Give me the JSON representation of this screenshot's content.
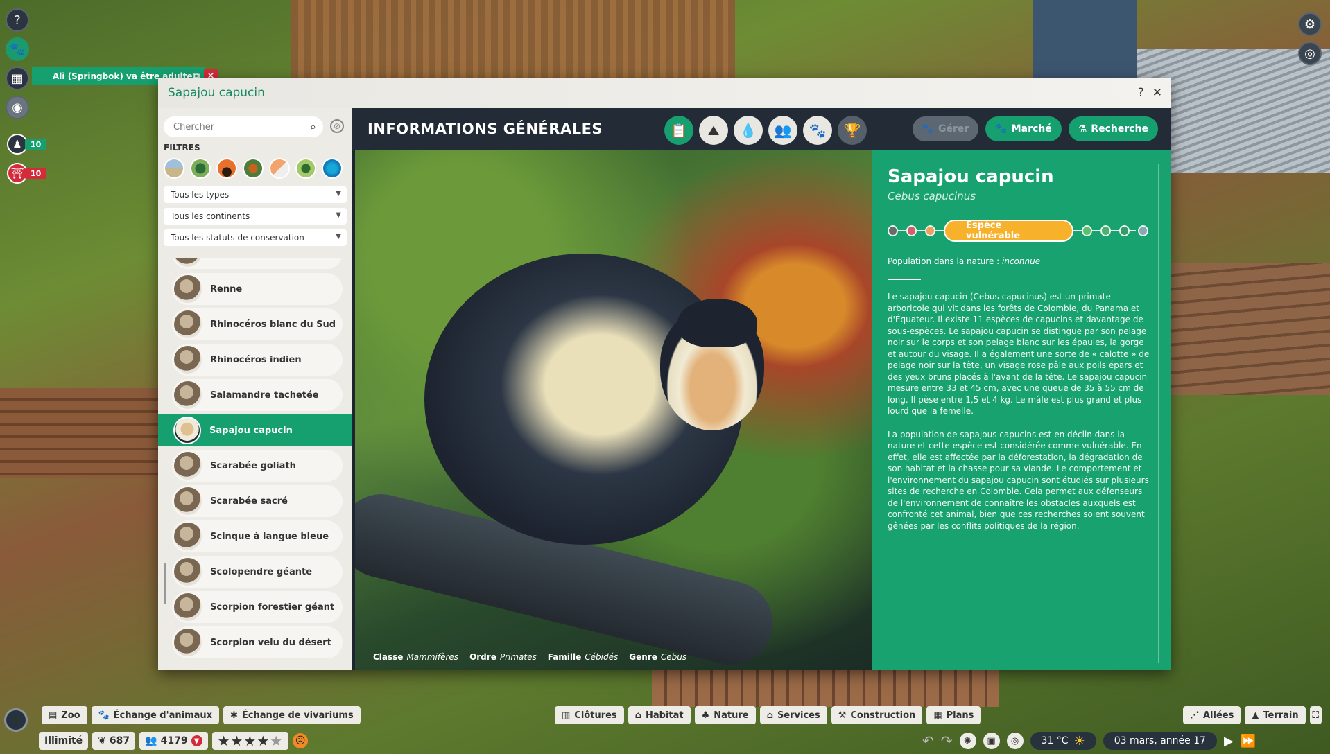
{
  "notification": {
    "text": "Ali (Springbok) va être adulte"
  },
  "hud": {
    "staff_count": "10",
    "guest_alert_count": "10"
  },
  "window": {
    "title": "Sapajou capucin",
    "help": "?",
    "close": "✕"
  },
  "sidebar": {
    "search_placeholder": "Chercher",
    "filters_label": "FILTRES",
    "dropdowns": [
      "Tous les types",
      "Tous les continents",
      "Tous les statuts de conservation"
    ],
    "animals": [
      {
        "name": "Renne"
      },
      {
        "name": "Rhinocéros blanc du Sud"
      },
      {
        "name": "Rhinocéros indien"
      },
      {
        "name": "Salamandre tachetée"
      },
      {
        "name": "Sapajou capucin"
      },
      {
        "name": "Scarabée goliath"
      },
      {
        "name": "Scarabée sacré"
      },
      {
        "name": "Scinque à langue bleue"
      },
      {
        "name": "Scolopendre géante"
      },
      {
        "name": "Scorpion forestier géant"
      },
      {
        "name": "Scorpion velu du désert"
      }
    ]
  },
  "content": {
    "header_title": "INFORMATIONS GÉNÉRALES",
    "buttons": {
      "manage": "Gérer",
      "market": "Marché",
      "research": "Recherche"
    }
  },
  "photo": {
    "taxonomy": [
      {
        "label": "Classe",
        "value": "Mammifères"
      },
      {
        "label": "Ordre",
        "value": "Primates"
      },
      {
        "label": "Famille",
        "value": "Cébidés"
      },
      {
        "label": "Genre",
        "value": "Cebus"
      }
    ]
  },
  "info": {
    "name": "Sapajou capucin",
    "latin": "Cebus capucinus",
    "conservation_status": "Espèce vulnérable",
    "population_label": "Population dans la nature :",
    "population_value": "inconnue",
    "description_1": "Le sapajou capucin (Cebus capucinus) est un primate arboricole qui vit dans les forêts de Colombie, du Panama et d'Équateur. Il existe 11 espèces de capucins et davantage de sous-espèces. Le sapajou capucin se distingue par son pelage noir sur le corps et son pelage blanc sur les épaules, la gorge et autour du visage. Il a également une sorte de « calotte » de pelage noir sur la tête, un visage rose pâle aux poils épars et des yeux bruns placés à l'avant de la tête. Le sapajou capucin mesure entre 33 et 45 cm, avec une queue de 35 à 55 cm de long. Il pèse entre 1,5 et 4 kg. Le mâle est plus grand et plus lourd que la femelle.",
    "description_2": "La population de sapajous capucins est en déclin dans la nature et cette espèce est considérée comme vulnérable. En effet, elle est affectée par la déforestation, la dégradation de son habitat et la chasse pour sa viande. Le comportement et l'environnement du sapajou capucin sont étudiés sur plusieurs sites de recherche en Colombie. Cela permet aux défenseurs de l'environnement de connaître les obstacles auxquels est confronté cet animal, bien que ces recherches soient souvent gênées par les conflits politiques de la région."
  },
  "bottom": {
    "left_tabs": [
      "Zoo",
      "Échange d'animaux",
      "Échange de vivariums"
    ],
    "center_tabs": [
      "Clôtures",
      "Habitat",
      "Nature",
      "Services",
      "Construction",
      "Plans"
    ],
    "right_tabs": [
      "Allées",
      "Terrain"
    ],
    "money": "Illimité",
    "conservation_credits": "687",
    "guests": "4179",
    "temperature": "31 °C",
    "date": "03 mars, année 17"
  },
  "colors": {
    "accent": "#16a070",
    "status_vulnerable": "#f7b12a",
    "dark": "#1d2530"
  }
}
